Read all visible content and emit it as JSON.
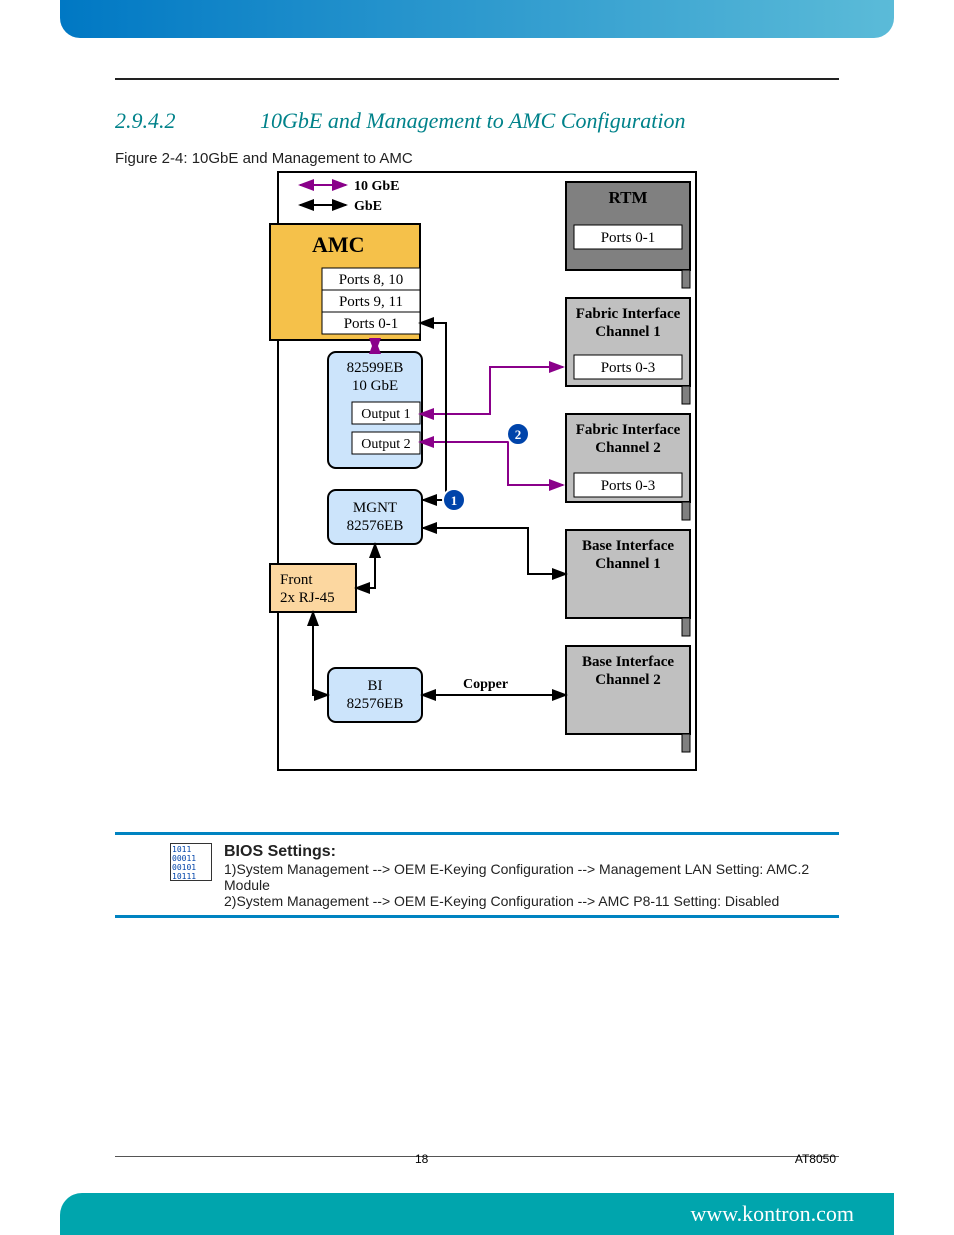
{
  "section": {
    "number": "2.9.4.2",
    "title": "10GbE and Management to AMC Configuration"
  },
  "figure_caption": "Figure 2-4: 10GbE and Management to AMC",
  "legend": {
    "l10": "10 GbE",
    "lgbe": "GbE"
  },
  "blocks": {
    "amc": "AMC",
    "amc_p810": "Ports 8, 10",
    "amc_p911": "Ports 9, 11",
    "amc_p01": "Ports 0-1",
    "nic10": {
      "name": "82599EB",
      "sub": "10 GbE",
      "out1": "Output 1",
      "out2": "Output 2"
    },
    "mgnt": {
      "line1": "MGNT",
      "line2": "82576EB"
    },
    "front": {
      "line1": "Front",
      "line2": "2x RJ-45"
    },
    "bi": {
      "line1": "BI",
      "line2": "82576EB"
    },
    "rtm": {
      "name": "RTM",
      "ports": "Ports 0-1"
    },
    "fic1": {
      "name1": "Fabric Interface",
      "name2": "Channel 1",
      "ports": "Ports 0-3"
    },
    "fic2": {
      "name1": "Fabric Interface",
      "name2": "Channel 2",
      "ports": "Ports 0-3"
    },
    "bic1": {
      "name1": "Base Interface",
      "name2": "Channel 1"
    },
    "bic2": {
      "name1": "Base Interface",
      "name2": "Channel 2"
    }
  },
  "badges": {
    "b1": "1",
    "b2": "2"
  },
  "copper_label": "Copper",
  "bios": {
    "title": "BIOS Settings:",
    "line1": "1)System Management --> OEM E-Keying Configuration --> Management LAN Setting: AMC.2 Module",
    "line2": "2)System Management --> OEM E-Keying Configuration --> AMC P8-11 Setting: Disabled",
    "icon_text": "1011\n00011\n00101\n10111"
  },
  "footer": {
    "page": "18",
    "model": "AT8050",
    "url": "www.kontron.com"
  }
}
